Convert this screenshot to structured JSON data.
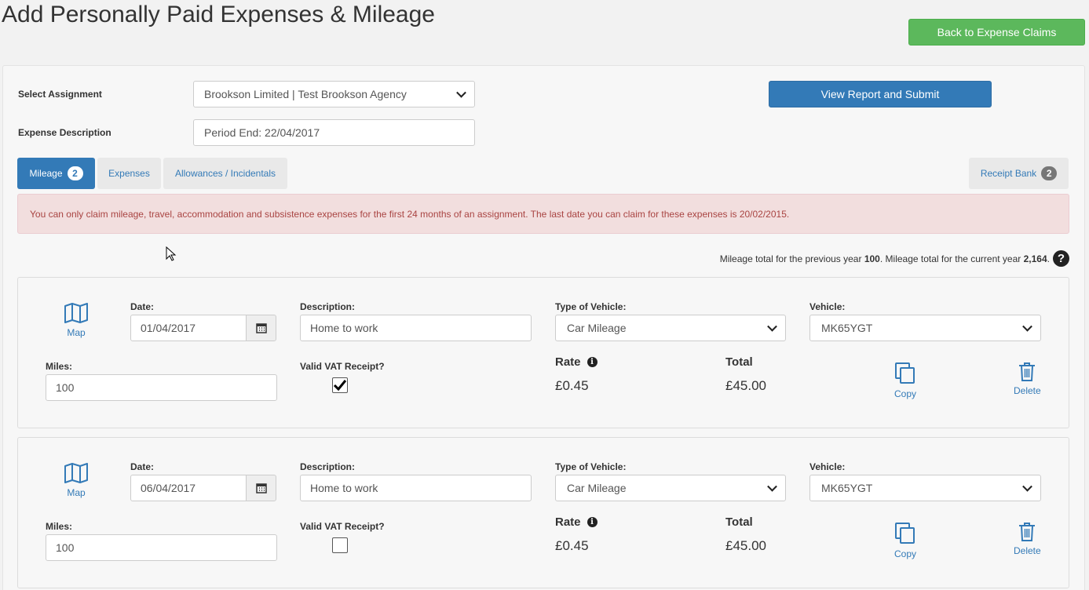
{
  "page": {
    "title": "Add Personally Paid Expenses & Mileage",
    "back_button": "Back to Expense Claims",
    "view_button": "View Report and Submit"
  },
  "form": {
    "assignment_label": "Select Assignment",
    "assignment_value": "Brookson Limited | Test Brookson Agency",
    "description_label": "Expense Description",
    "description_value": "Period End: 22/04/2017"
  },
  "tabs": [
    {
      "label": "Mileage",
      "badge": "2",
      "active": true
    },
    {
      "label": "Expenses"
    },
    {
      "label": "Allowances / Incidentals"
    }
  ],
  "receipt_bank": {
    "label": "Receipt Bank",
    "badge": "2"
  },
  "alert": "You can only claim mileage, travel, accommodation and subsistence expenses for the first 24 months of an assignment. The last date you can claim for these expenses is 20/02/2015.",
  "mileage_summary": {
    "prefix": "Mileage total for the previous year",
    "previous": "100",
    "middle": ". Mileage total for the current year",
    "current": "2,164",
    "suffix": "."
  },
  "labels": {
    "map": "Map",
    "date": "Date:",
    "description": "Description:",
    "type_of_vehicle": "Type of Vehicle:",
    "vehicle": "Vehicle:",
    "miles": "Miles:",
    "valid_vat": "Valid VAT Receipt?",
    "rate": "Rate",
    "total": "Total",
    "copy": "Copy",
    "delete": "Delete"
  },
  "entries": [
    {
      "date": "01/04/2017",
      "description": "Home to work",
      "vehicle_type": "Car Mileage",
      "vehicle": "MK65YGT",
      "miles": "100",
      "vat_receipt": true,
      "rate": "£0.45",
      "total": "£45.00"
    },
    {
      "date": "06/04/2017",
      "description": "Home to work",
      "vehicle_type": "Car Mileage",
      "vehicle": "MK65YGT",
      "miles": "100",
      "vat_receipt": false,
      "rate": "£0.45",
      "total": "£45.00"
    }
  ],
  "colors": {
    "primary": "#337ab7",
    "success": "#5cb85c",
    "alert_bg": "#f2dede",
    "alert_text": "#a94442"
  }
}
